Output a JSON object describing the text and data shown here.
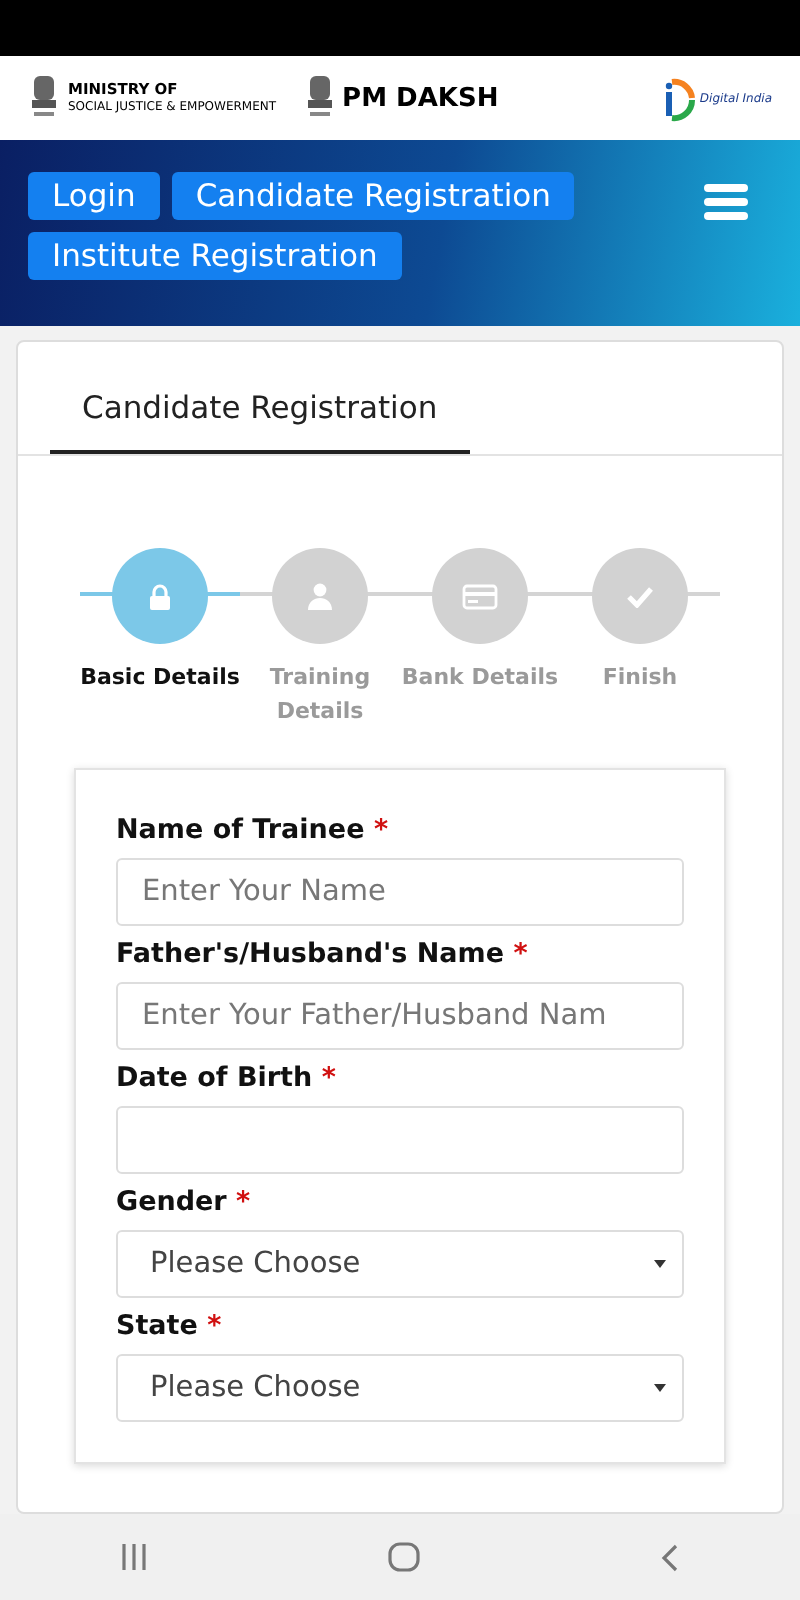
{
  "header": {
    "ministry_line1": "MINISTRY OF",
    "ministry_line2": "SOCIAL JUSTICE & EMPOWERMENT",
    "brand": "PM DAKSH",
    "digital_india": "Digital India"
  },
  "nav_buttons": [
    {
      "label": "Login"
    },
    {
      "label": "Candidate Registration"
    },
    {
      "label": "Institute Registration"
    }
  ],
  "tab": {
    "label": "Candidate Registration",
    "selected": true
  },
  "steps": [
    {
      "label": "Basic Details",
      "kind": "lock",
      "selected": true
    },
    {
      "label": "Training Details",
      "kind": "user",
      "selected": false
    },
    {
      "label": "Bank Details",
      "kind": "card",
      "selected": false
    },
    {
      "label": "Finish",
      "kind": "check",
      "selected": false
    }
  ],
  "fields": [
    {
      "kind": "text",
      "label": "Name of Trainee",
      "required_mark": "*",
      "placeholder": "Enter Your Name"
    },
    {
      "kind": "text",
      "label": "Father's/Husband's Name",
      "required_mark": "*",
      "placeholder": "Enter Your Father/Husband Nam"
    },
    {
      "kind": "date",
      "label": "Date of Birth",
      "required_mark": "*"
    },
    {
      "kind": "select",
      "label": "Gender",
      "required_mark": "*",
      "value": "Please Choose"
    },
    {
      "kind": "select",
      "label": "State",
      "required_mark": "*",
      "value": "Please Choose"
    }
  ]
}
